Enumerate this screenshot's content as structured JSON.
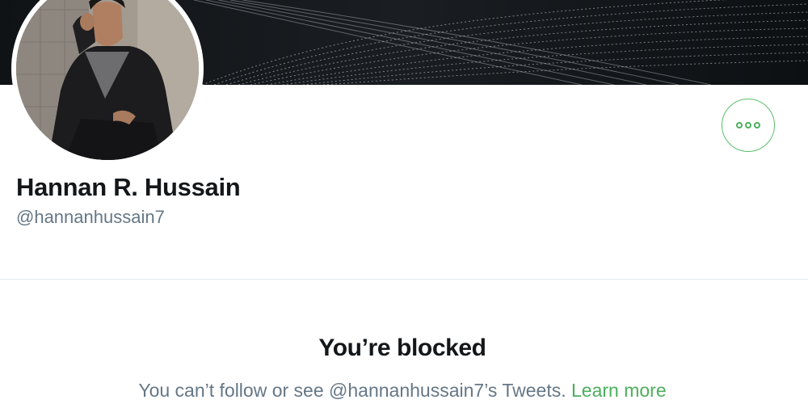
{
  "profile": {
    "display_name": "Hannan R. Hussain",
    "handle": "@hannanhussain7",
    "more_button_icon": "more-horizontal-icon"
  },
  "blocked": {
    "title": "You’re blocked",
    "message": "You can’t follow or see @hannanhussain7’s Tweets.",
    "link_label": "Learn more"
  },
  "colors": {
    "accent": "#4caf5c",
    "text_primary": "#14171a",
    "text_secondary": "#657786",
    "banner_background": "#0f1215",
    "divider": "#e1e8ed"
  }
}
